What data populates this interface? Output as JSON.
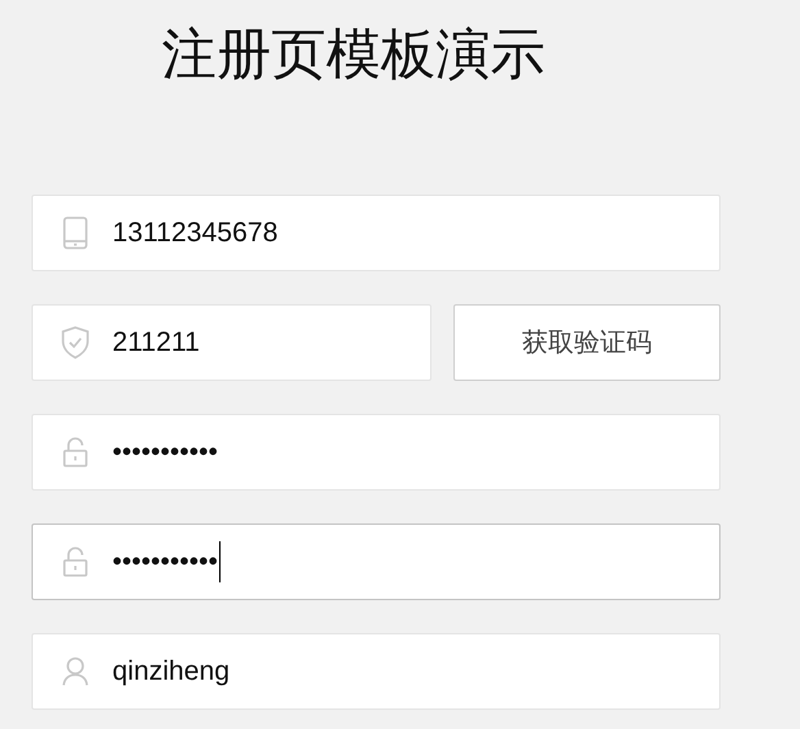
{
  "title": "注册页模板演示",
  "fields": [
    {
      "kind": "phone",
      "value": "13112345678",
      "focused": false
    },
    {
      "kind": "code",
      "value": "211211",
      "focused": false,
      "button": "获取验证码"
    },
    {
      "kind": "lock",
      "value": "•••••••••••",
      "focused": false
    },
    {
      "kind": "lock",
      "value": "•••••••••••",
      "focused": true
    },
    {
      "kind": "user",
      "value": "qinziheng",
      "focused": false
    }
  ]
}
